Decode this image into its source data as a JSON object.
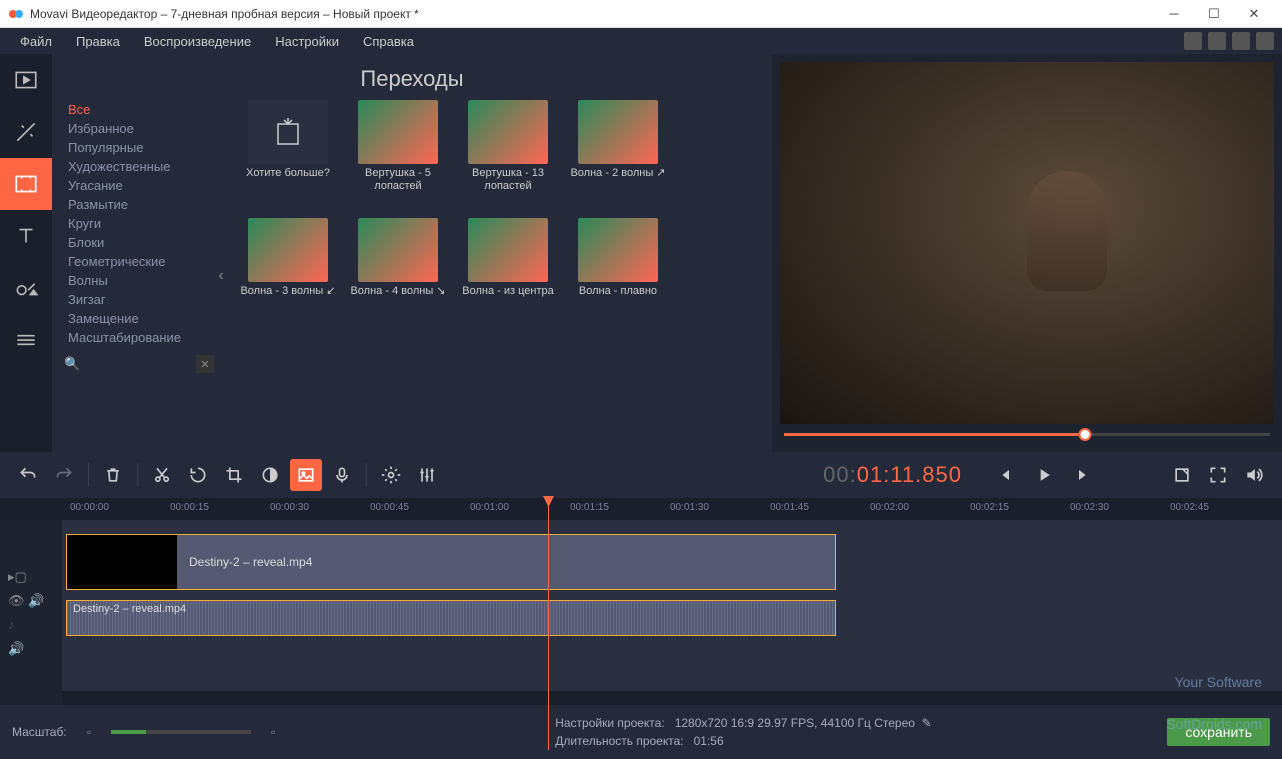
{
  "window": {
    "title": "Movavi Видеоредактор – 7-дневная пробная версия – Новый проект *"
  },
  "menu": [
    "Файл",
    "Правка",
    "Воспроизведение",
    "Настройки",
    "Справка"
  ],
  "panel": {
    "title": "Переходы",
    "categories": [
      "Все",
      "Избранное",
      "Популярные",
      "Художественные",
      "Угасание",
      "Размытие",
      "Круги",
      "Блоки",
      "Геометрические",
      "Волны",
      "Зигзаг",
      "Замещение",
      "Масштабирование"
    ],
    "active_category": 0,
    "thumbs": [
      {
        "label": "Хотите больше?",
        "more": true
      },
      {
        "label": "Вертушка - 5 лопастей"
      },
      {
        "label": "Вертушка - 13 лопастей"
      },
      {
        "label": "Волна - 2 волны ↗"
      },
      {
        "label": "Волна - 3 волны ↙"
      },
      {
        "label": "Волна - 4 волны ↘"
      },
      {
        "label": "Волна - из центра"
      },
      {
        "label": "Волна - плавно"
      }
    ]
  },
  "timecode": {
    "gray": "00:",
    "main": "01:11.850"
  },
  "ruler_ticks": [
    "00:00:00",
    "00:00:15",
    "00:00:30",
    "00:00:45",
    "00:01:00",
    "00:01:15",
    "00:01:30",
    "00:01:45",
    "00:02:00",
    "00:02:15",
    "00:02:30",
    "00:02:45"
  ],
  "clips": {
    "video": "Destiny-2 – reveal.mp4",
    "audio": "Destiny-2 – reveal.mp4"
  },
  "status": {
    "zoom_label": "Масштаб:",
    "settings_label": "Настройки проекта:",
    "settings_value": "1280x720 16:9 29.97 FPS, 44100 Гц Стерео",
    "duration_label": "Длительность проекта:",
    "duration_value": "01:56",
    "save": "сохранить"
  },
  "watermark1": "Your Software",
  "watermark2": "SoftDroids.com"
}
